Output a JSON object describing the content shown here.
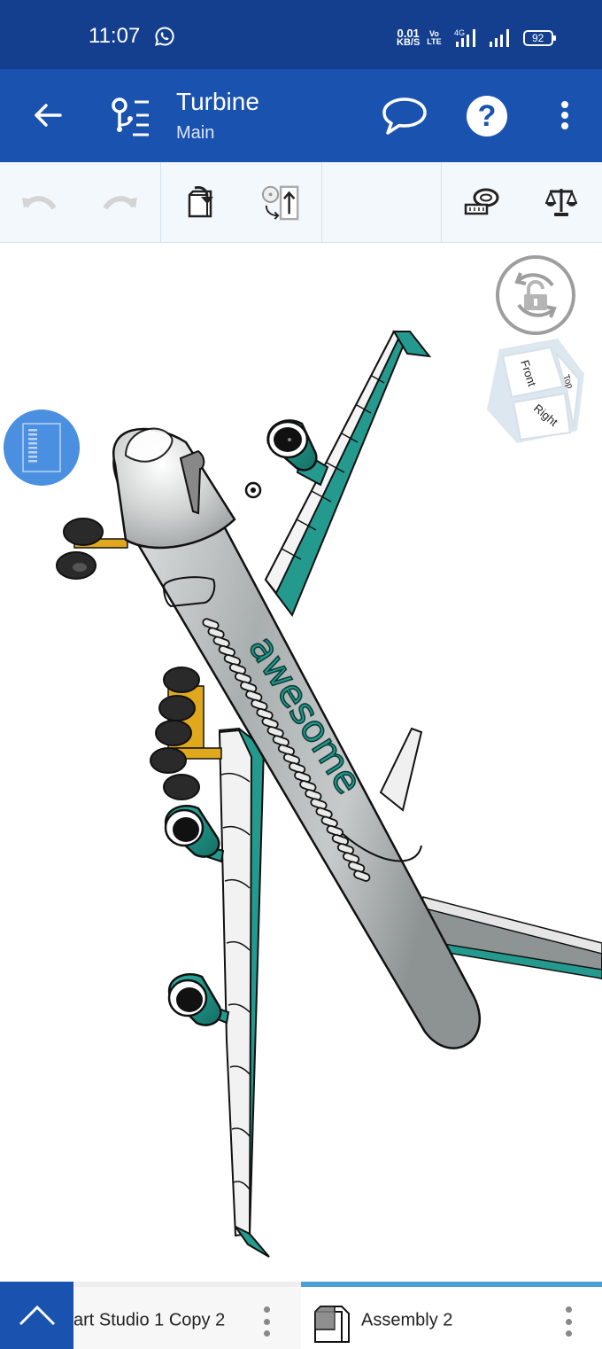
{
  "status_bar": {
    "time": "11:07",
    "notification_icon": "whatsapp-icon",
    "net_speed_value": "0.01",
    "net_speed_unit": "KB/S",
    "volte_top": "Vo",
    "volte_bottom": "LTE",
    "network_type": "4G",
    "battery_level": "92"
  },
  "app_bar": {
    "title": "Turbine",
    "subtitle": "Main",
    "icons": [
      "back-arrow-icon",
      "version-tree-icon",
      "comment-icon",
      "help-icon",
      "more-vert-icon"
    ],
    "help_glyph": "?"
  },
  "toolbar": {
    "undo_enabled": false,
    "redo_enabled": false,
    "tools": [
      "undo",
      "redo",
      "insert-part",
      "mate-connector",
      "measure",
      "mass-properties"
    ]
  },
  "viewport": {
    "model_text": "awesome",
    "viewcube": {
      "front": "Front",
      "top": "Top",
      "right": "Right"
    },
    "colors": {
      "fuselage": "#b7bcbd",
      "accent": "#249a8e",
      "gear": "#e0a81c",
      "tire": "#2a2a2a"
    }
  },
  "bottom_tabs": {
    "tabs": [
      {
        "label": "art Studio 1 Copy 2",
        "type": "part-studio",
        "active": false
      },
      {
        "label": "Assembly 2",
        "type": "assembly",
        "active": true
      }
    ]
  },
  "colors": {
    "status_bar": "#143f8f",
    "app_bar": "#1a52b0",
    "toolbar_bg": "#f3f8fd",
    "active_tab_indicator": "#4a9fd6",
    "fab": "#4a8fe0"
  }
}
